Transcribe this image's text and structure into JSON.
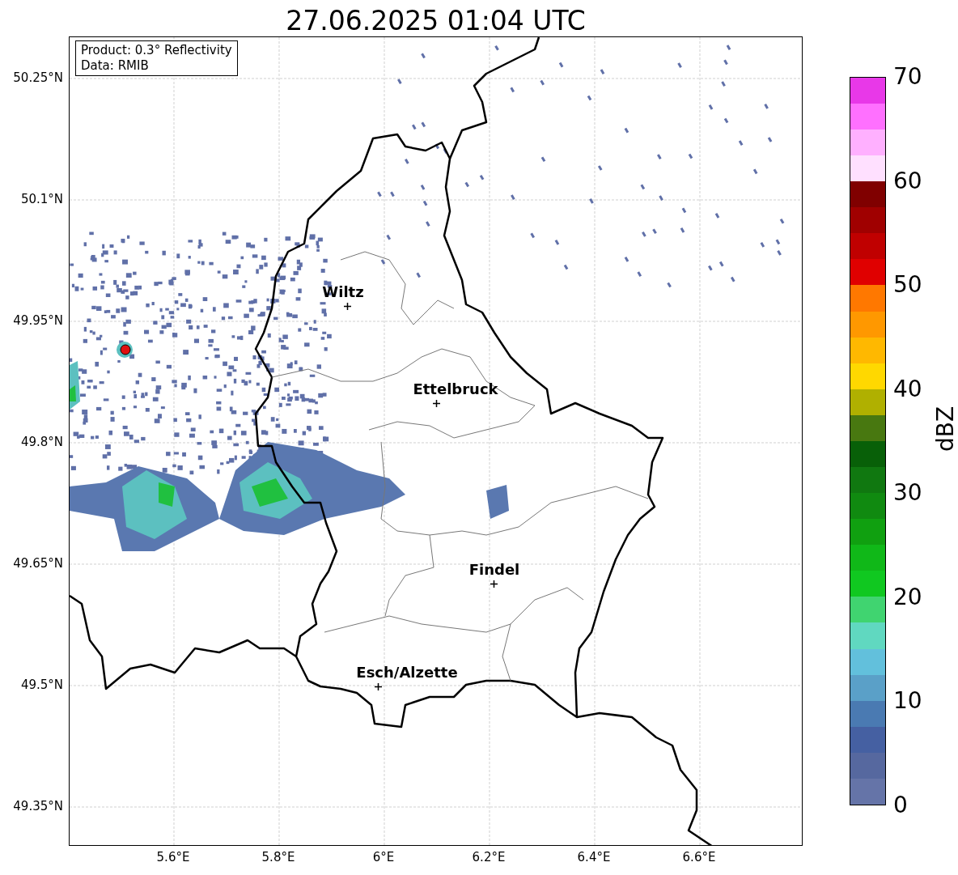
{
  "title": "27.06.2025 01:04 UTC",
  "info_box": [
    "Product: 0.3° Reflectivity",
    "Data: RMIB"
  ],
  "map": {
    "cities": [
      "Wiltz",
      "Ettelbruck",
      "Findel",
      "Esch/Alzette"
    ],
    "x_ticks": [
      "5.6°E",
      "5.8°E",
      "6°E",
      "6.2°E",
      "6.4°E",
      "6.6°E"
    ],
    "y_ticks": [
      "50.25°N",
      "50.1°N",
      "49.95°N",
      "49.8°N",
      "49.65°N",
      "49.5°N",
      "49.35°N"
    ]
  },
  "colorbar": {
    "label": "dBZ",
    "ticks": [
      "70",
      "60",
      "50",
      "40",
      "30",
      "20",
      "10",
      "0"
    ],
    "bands": [
      {
        "color": "#6574a8"
      },
      {
        "color": "#56689f"
      },
      {
        "color": "#4560a2"
      },
      {
        "color": "#4a7ab2"
      },
      {
        "color": "#5aa0c8"
      },
      {
        "color": "#62c0dc"
      },
      {
        "color": "#60d8c0"
      },
      {
        "color": "#40d470"
      },
      {
        "color": "#10c820"
      },
      {
        "color": "#10b818"
      },
      {
        "color": "#10a010"
      },
      {
        "color": "#108a10"
      },
      {
        "color": "#107810"
      },
      {
        "color": "#086008"
      },
      {
        "color": "#487810"
      },
      {
        "color": "#b0b000"
      },
      {
        "color": "#ffd800"
      },
      {
        "color": "#ffb800"
      },
      {
        "color": "#ff9800"
      },
      {
        "color": "#ff7800"
      },
      {
        "color": "#e00000"
      },
      {
        "color": "#c00000"
      },
      {
        "color": "#a00000"
      },
      {
        "color": "#800000"
      },
      {
        "color": "#ffe0ff"
      },
      {
        "color": "#ffb0ff"
      },
      {
        "color": "#ff70ff"
      },
      {
        "color": "#e838e8"
      }
    ]
  }
}
